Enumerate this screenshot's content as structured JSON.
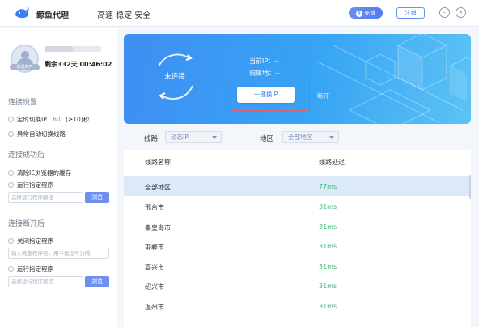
{
  "app": {
    "name": "鲸鱼代理",
    "slogan": "高速 稳定 安全"
  },
  "header": {
    "recharge_label": "充值",
    "logout_label": "注销",
    "minimize_glyph": "–",
    "close_glyph": "×"
  },
  "user": {
    "badge": "普通用户",
    "remaining": "剩余332天 00:46:02"
  },
  "sidebar": {
    "connect_settings": {
      "title": "连接设置",
      "timed_switch": {
        "label": "定时切换IP",
        "value": "60",
        "hint": "(≥10)秒"
      },
      "auto_switch": {
        "label": "异常自动切换线路"
      }
    },
    "after_connect": {
      "title": "连接成功后",
      "clear_cache": {
        "label": "清除IE浏览器的缓存"
      },
      "run_program": {
        "label": "运行指定程序"
      },
      "path_placeholder": "选择运行程序路径",
      "browse_label": "浏览"
    },
    "after_disconnect": {
      "title": "连接断开后",
      "close_program": {
        "label": "关闭指定程序"
      },
      "close_placeholder": "输入完整程序名，用半角逗号分隔",
      "run_program": {
        "label": "运行指定程序"
      },
      "path_placeholder": "选择运行程序路径",
      "browse_label": "浏览"
    }
  },
  "banner": {
    "status": "未连接",
    "current_ip_label": "当前IP：",
    "current_ip_value": "--",
    "region_label": "归属地：",
    "region_value": "--",
    "switch_button": "一键换IP",
    "disconnect": "断开"
  },
  "filters": {
    "line_label": "线路",
    "line_value": "动态IP",
    "region_label": "地区",
    "region_value": "全部地区"
  },
  "table": {
    "col_name": "线路名称",
    "col_latency": "线路延迟",
    "rows": [
      {
        "name": "全部地区",
        "latency": "77ms"
      },
      {
        "name": "邢台市",
        "latency": "31ms"
      },
      {
        "name": "秦皇岛市",
        "latency": "31ms"
      },
      {
        "name": "邯郸市",
        "latency": "31ms"
      },
      {
        "name": "嘉兴市",
        "latency": "31ms"
      },
      {
        "name": "绍兴市",
        "latency": "31ms"
      },
      {
        "name": "温州市",
        "latency": "31ms"
      }
    ]
  },
  "colors": {
    "accent": "#4f7cf0",
    "banner_start": "#3f8ef2",
    "banner_end": "#5cc3f4",
    "latency_green": "#3db87a",
    "selected_row": "#dbe9f8",
    "highlight_box": "#e25b6a"
  }
}
